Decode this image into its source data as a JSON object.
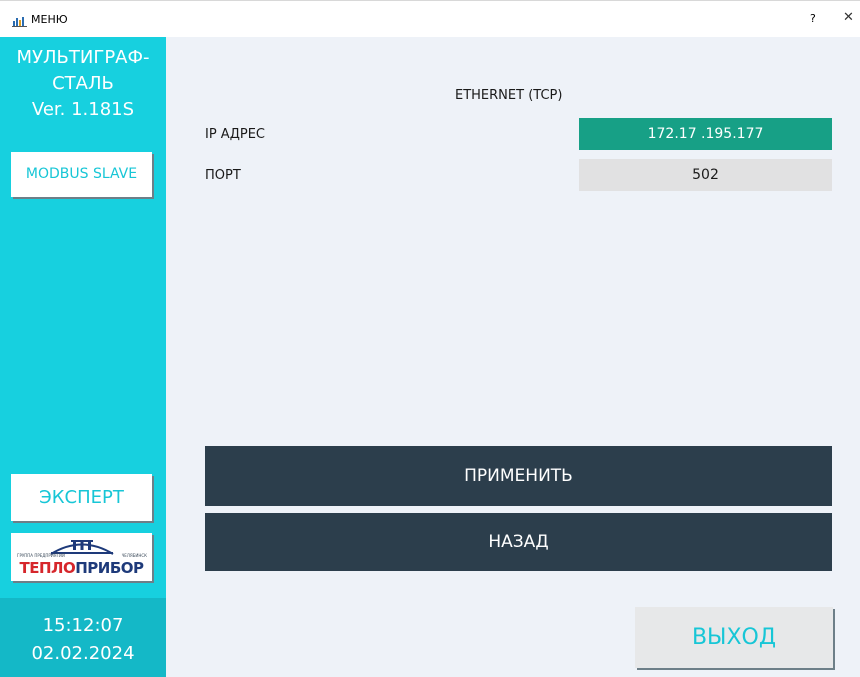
{
  "window": {
    "title": "МЕНЮ",
    "help_label": "?",
    "close_label": "✕"
  },
  "sidebar": {
    "brand_line1": "МУЛЬТИГРАФ-",
    "brand_line2": "СТАЛЬ",
    "version": "Ver. 1.181S",
    "modbus_button": "MODBUS SLAVE",
    "expert_button": "ЭКСПЕРТ",
    "logo": {
      "tagline_left": "ГРУППА ПРЕДПРИЯТИЙ",
      "tagline_right": "ЧЕЛЯБИНСК",
      "name_part1": "ТЕПЛО",
      "name_part2": "ПРИБОР"
    },
    "time": "15:12:07",
    "date": "02.02.2024"
  },
  "main": {
    "section_title": "ETHERNET (TCP)",
    "ip_label": "IP АДРЕС",
    "ip_value": "172.17 .195.177",
    "port_label": "ПОРТ",
    "port_value": "502",
    "apply_button": "ПРИМЕНИТЬ",
    "back_button": "НАЗАД",
    "exit_button": "ВЫХОД"
  },
  "colors": {
    "sidebar": "#17d0df",
    "accent_text": "#17c6d6",
    "ip_field": "#17a086",
    "dark_button": "#2c3e4c",
    "background": "#eef2f8"
  },
  "icons": {
    "app_icon": "bar-chart-icon",
    "close_icon": "close-icon"
  }
}
